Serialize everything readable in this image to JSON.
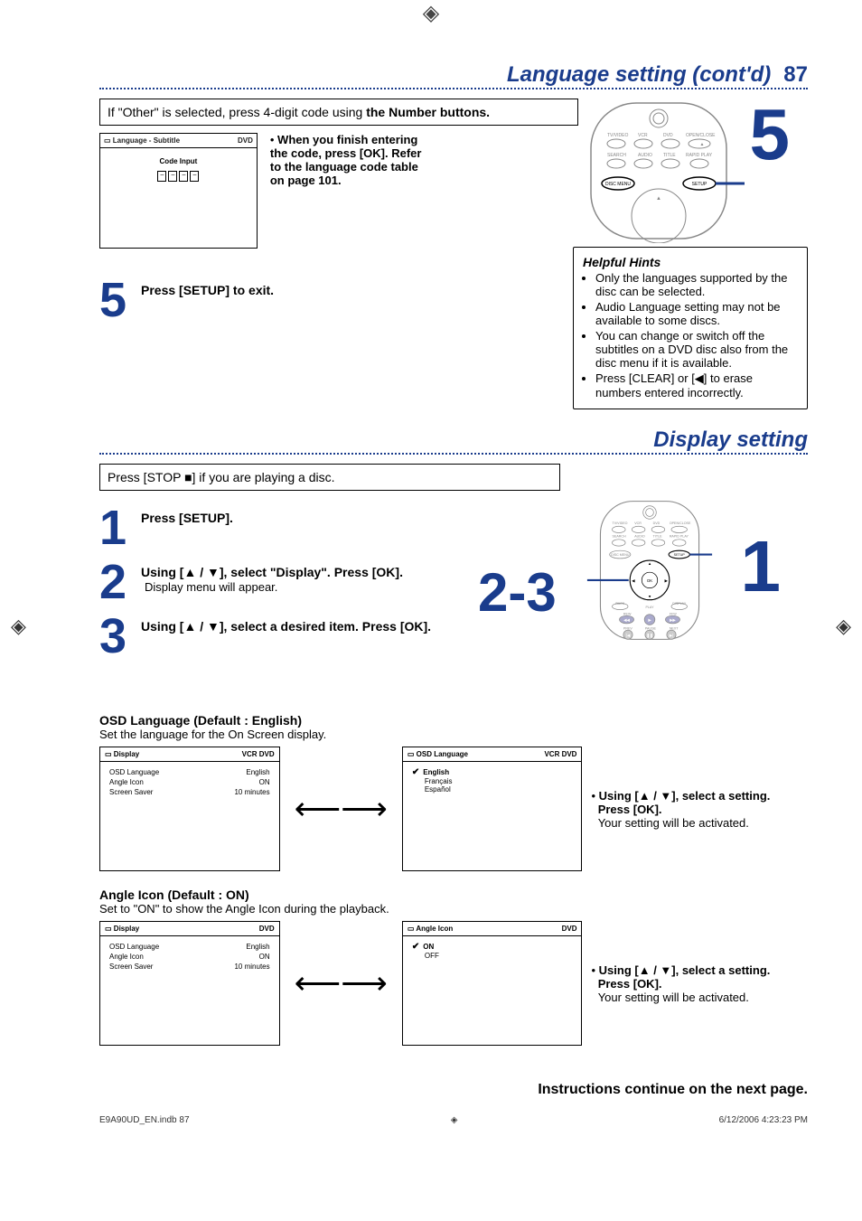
{
  "page": {
    "crop_glyph": "◈"
  },
  "section_language": {
    "title": "Language setting (cont'd)",
    "page_number": "87",
    "framed_note_prefix": "If \"Other\" is selected, press 4-digit code using ",
    "framed_note_bold": "the Number buttons.",
    "mini_panel_title": "Language - Subtitle",
    "mini_panel_tag": "DVD",
    "code_input_label": "Code Input",
    "code_placeholder": "–",
    "when_finish_lines": [
      "When you finish entering",
      "the code, press [OK]. Refer",
      "to the language code table",
      "on page 101."
    ],
    "step5": "Press [SETUP] to exit.",
    "big5": "5",
    "remote_labels": {
      "row1": [
        "TV/VIDEO",
        "VCR",
        "DVD",
        "OPEN/CLOSE"
      ],
      "row2": [
        "SEARCH",
        "AUDIO",
        "TITLE",
        "RAPID PLAY"
      ],
      "btn_disc_menu": "DISC MENU",
      "btn_setup": "SETUP"
    },
    "hints_title": "Helpful Hints",
    "hints": [
      "Only the languages supported by the disc can be selected.",
      "Audio Language setting may not be available to some discs.",
      "You can change or switch off the subtitles on a DVD disc also from the disc menu if it is available.",
      "Press [CLEAR] or [◀] to erase numbers entered incorrectly."
    ]
  },
  "section_display": {
    "title": "Display setting",
    "stop_framed": "Press [STOP ■] if you are playing a disc.",
    "steps": [
      {
        "num": "1",
        "main": "Press [SETUP]."
      },
      {
        "num": "2",
        "main": "Using [▲ / ▼], select \"Display\". Press [OK].",
        "sub": "Display menu will appear."
      },
      {
        "num": "3",
        "main": "Using [▲ / ▼], select a desired item. Press [OK]."
      }
    ],
    "big23": "2-3",
    "big1": "1",
    "remote_labels": {
      "row1": [
        "TV/VIDEO",
        "VCR",
        "DVD",
        "OPEN/CLOSE"
      ],
      "row2": [
        "SEARCH",
        "AUDIO",
        "TITLE",
        "RAPID PLAY"
      ],
      "btn_disc_menu": "DISC MENU",
      "btn_setup": "SETUP",
      "ok": "OK",
      "back": "BACK",
      "display": "DISPLAY",
      "play": "PLAY",
      "rew": "REW",
      "ffw": "FFW",
      "prev": "PREV",
      "pause": "PAUSE",
      "next": "NEXT"
    },
    "osd_section": {
      "label": "OSD Language (Default : English)",
      "desc": "Set the language for the On Screen display.",
      "panel_a": {
        "title": "Display",
        "tags": "VCR DVD",
        "rows": [
          [
            "OSD Language",
            "English"
          ],
          [
            "Angle Icon",
            "ON"
          ],
          [
            "Screen Saver",
            "10 minutes"
          ]
        ]
      },
      "panel_b": {
        "title": "OSD Language",
        "tags": "VCR DVD",
        "options": [
          "English",
          "Français",
          "Español"
        ],
        "selected_index": 0
      },
      "note_bold1": "Using [▲ / ▼], select a setting.",
      "note_bold2": "Press [OK].",
      "note_plain": "Your setting will be activated."
    },
    "angle_section": {
      "label": "Angle Icon (Default : ON)",
      "desc": "Set to \"ON\" to show the Angle Icon during the playback.",
      "panel_a": {
        "title": "Display",
        "tags": "DVD",
        "rows": [
          [
            "OSD Language",
            "English"
          ],
          [
            "Angle Icon",
            "ON"
          ],
          [
            "Screen Saver",
            "10 minutes"
          ]
        ]
      },
      "panel_b": {
        "title": "Angle Icon",
        "tags": "DVD",
        "options": [
          "ON",
          "OFF"
        ],
        "selected_index": 0
      },
      "note_bold1": "Using [▲ / ▼], select a setting.",
      "note_bold2": "Press [OK].",
      "note_plain": "Your setting will be activated."
    }
  },
  "continue_note": "Instructions continue on the next page.",
  "footer": {
    "left": "E9A90UD_EN.indb   87",
    "right": "6/12/2006   4:23:23 PM"
  },
  "icons": {
    "square": "▢",
    "check": "✔",
    "arrow_lr": "⟵⟶",
    "bullet": "•",
    "tvglyph": "▭"
  }
}
